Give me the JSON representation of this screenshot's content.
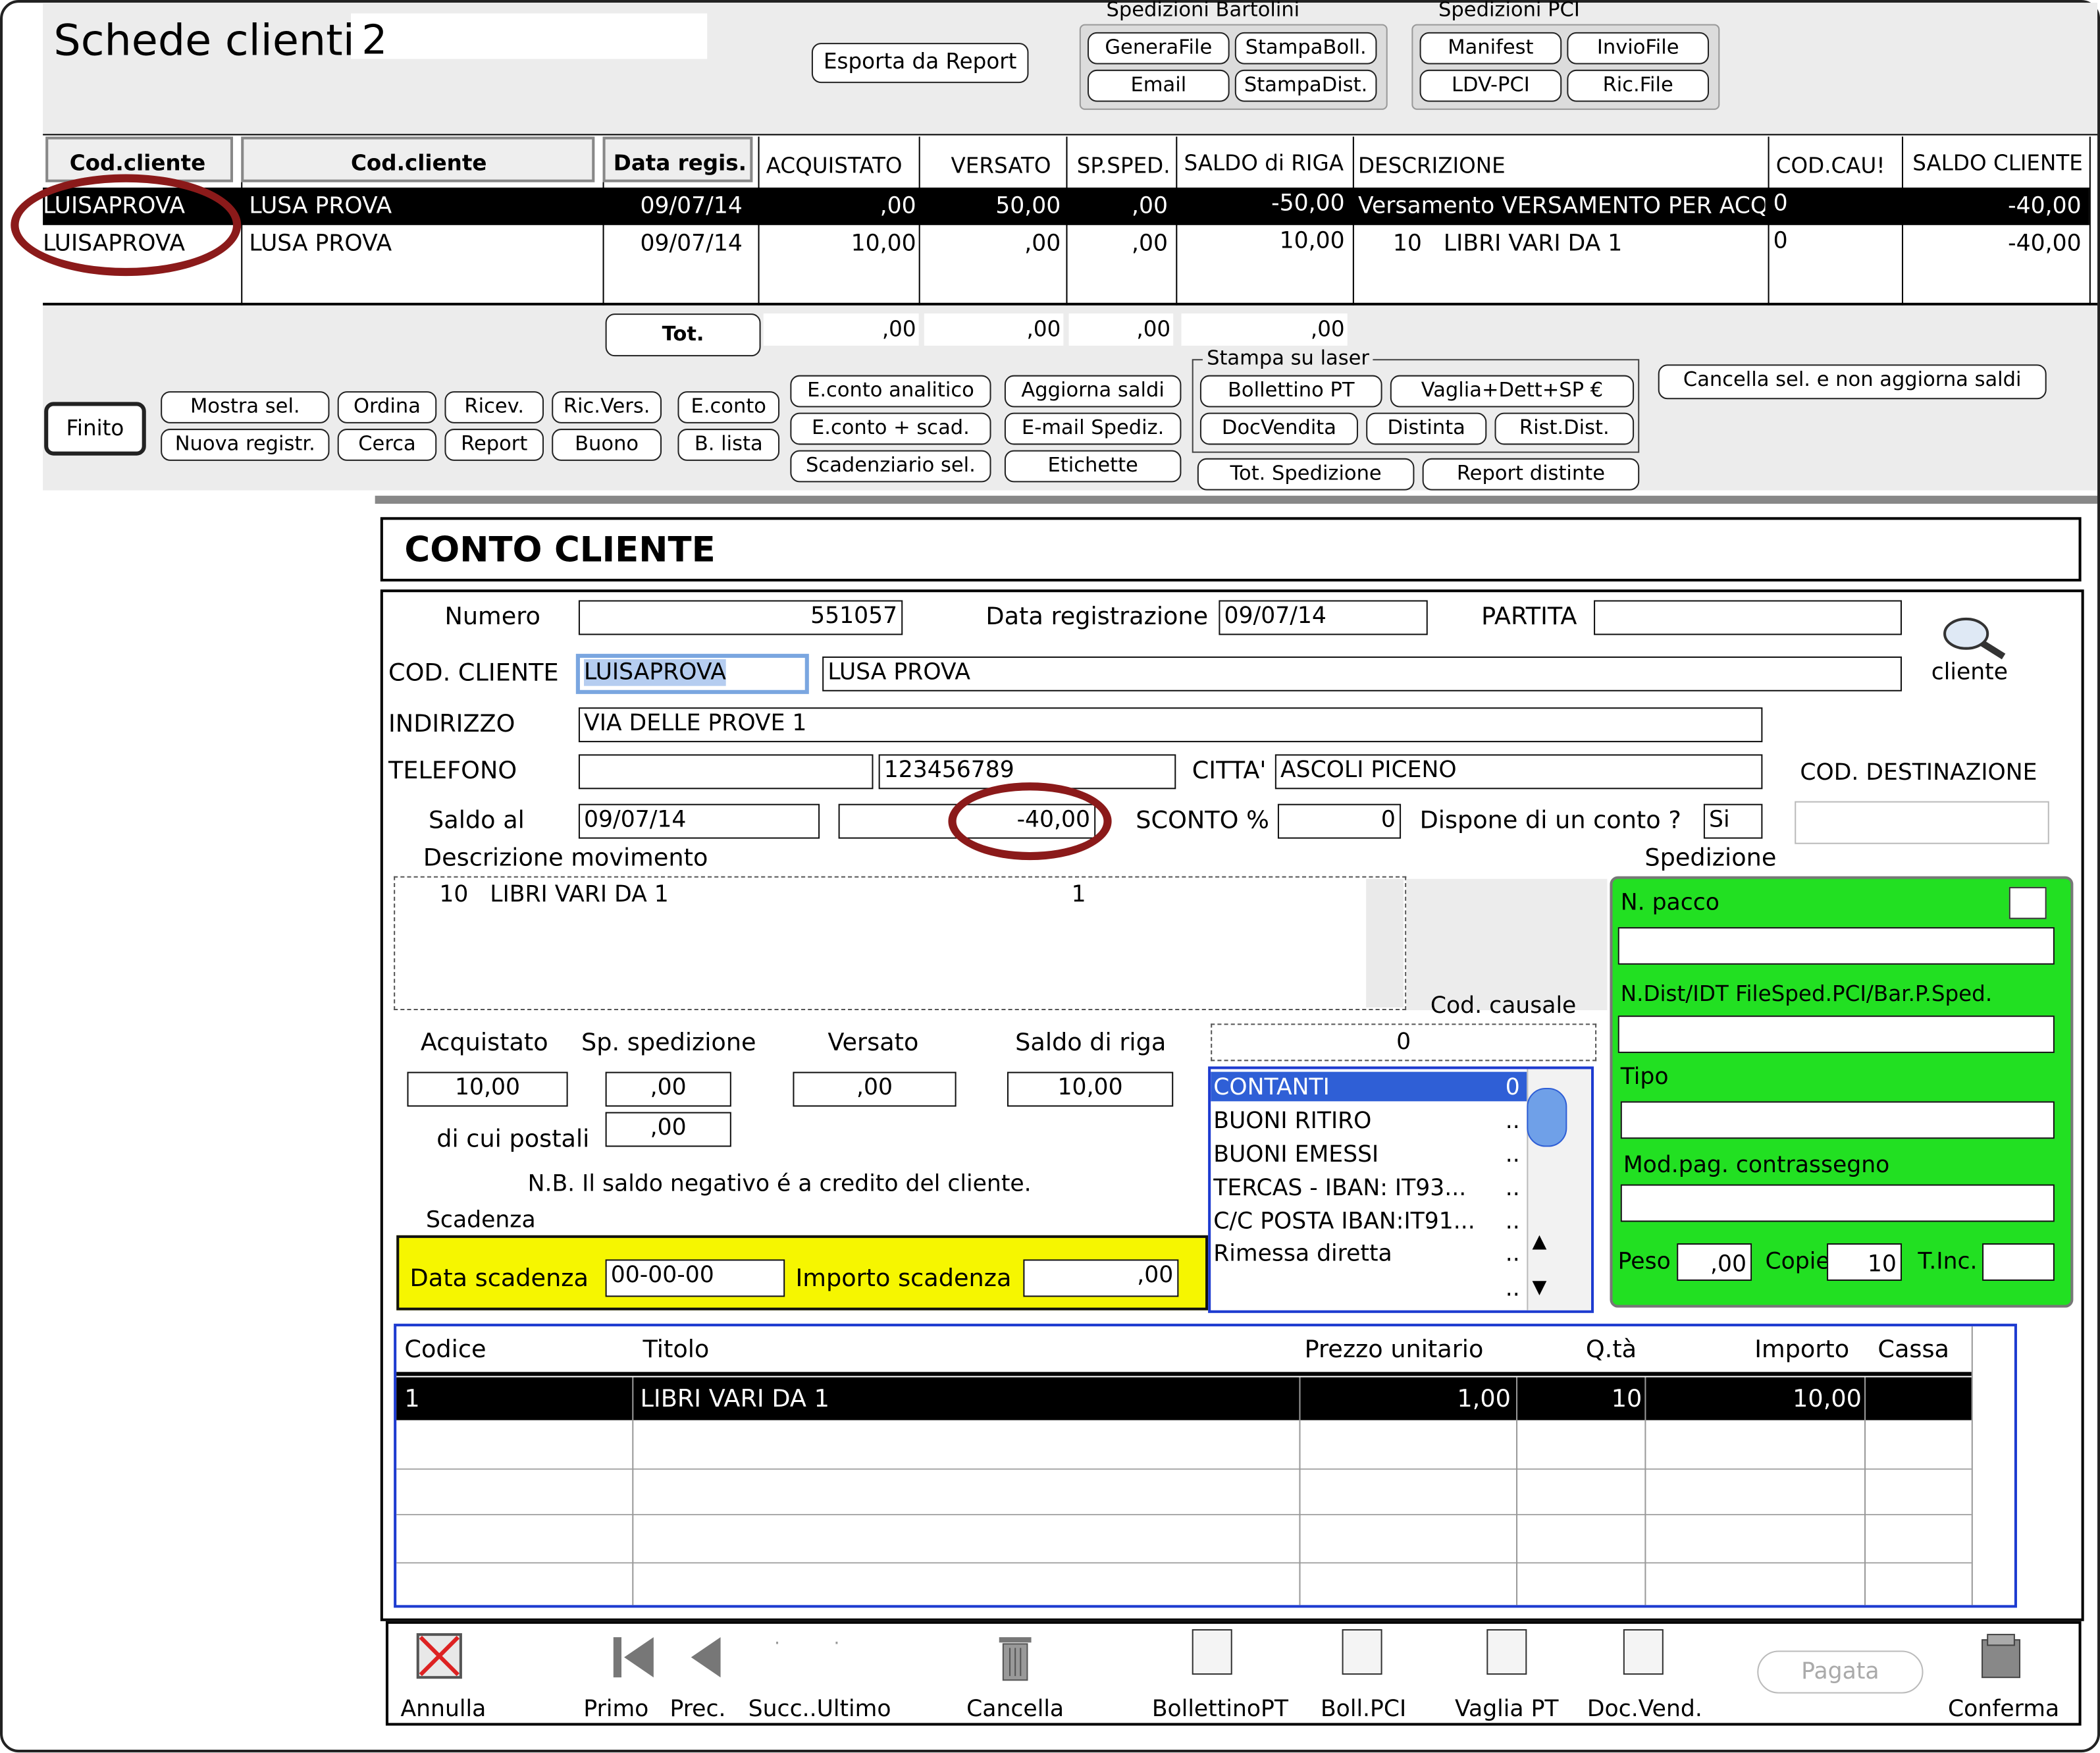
{
  "window": {
    "title": "Schede clienti",
    "count": "2"
  },
  "header_buttons": {
    "esporta": "Esporta da Report"
  },
  "bartolini": {
    "title": "Spedizioni Bartolini",
    "buttons": [
      "GeneraFile",
      "StampaBoll.",
      "Email",
      "StampaDist."
    ]
  },
  "pci": {
    "title": "Spedizioni PCI",
    "buttons": [
      "Manifest",
      "InvioFile",
      "LDV-PCI",
      "Ric.File"
    ]
  },
  "list": {
    "headers": [
      "Cod.cliente",
      "Cod.cliente",
      "Data regis.",
      "ACQUISTATO",
      "VERSATO",
      "SP.SPED.",
      "SALDO di RIGA",
      "DESCRIZIONE",
      "COD.CAU!",
      "SALDO CLIENTE"
    ],
    "rows": [
      {
        "cod": "LUISAPROVA",
        "nome": "LUSA PROVA",
        "data": "09/07/14",
        "acquistato": ",00",
        "versato": "50,00",
        "sped": ",00",
        "saldo_riga": "-50,00",
        "descrizione": "Versamento VERSAMENTO PER ACQU",
        "cau": "0",
        "saldo_cliente": "-40,00"
      },
      {
        "cod": "LUISAPROVA",
        "nome": "LUSA PROVA",
        "data": "09/07/14",
        "acquistato": "10,00",
        "versato": ",00",
        "sped": ",00",
        "saldo_riga": "10,00",
        "descrizione": "10   LIBRI VARI DA 1",
        "cau": "0",
        "saldo_cliente": "-40,00"
      }
    ],
    "totals": {
      "button": "Tot.",
      "acquistato": ",00",
      "versato": ",00",
      "sped": ",00",
      "saldo": ",00"
    }
  },
  "actions": {
    "finito": "Finito",
    "mostra": "Mostra sel.",
    "nuova": "Nuova registr.",
    "ordina": "Ordina",
    "cerca": "Cerca",
    "ricev": "Ricev.",
    "report": "Report",
    "ricvers": "Ric.Vers.",
    "buono": "Buono",
    "econto": "E.conto",
    "blista": "B. lista",
    "econto_anal": "E.conto analitico",
    "econto_scad": "E.conto + scad.",
    "scadenziario": "Scadenziario sel.",
    "aggiorna": "Aggiorna saldi",
    "email_sped": "E-mail Spediz.",
    "etichette": "Etichette",
    "laser_title": "Stampa su laser",
    "bollettino": "Bollettino PT",
    "vaglia": "Vaglia+Dett+SP €",
    "docvendita": "DocVendita",
    "distinta": "Distinta",
    "rist": "Rist.Dist.",
    "tot_sped": "Tot. Spedizione",
    "report_dist": "Report distinte",
    "cancella": "Cancella sel. e non aggiorna saldi"
  },
  "form": {
    "title": "CONTO  CLIENTE",
    "numero_label": "Numero",
    "numero": "551057",
    "data_label": "Data registrazione",
    "data": "09/07/14",
    "partita_label": "PARTITA",
    "partita": "",
    "cliente_icon_label": "cliente",
    "cod_label": "COD. CLIENTE",
    "cod": "LUISAPROVA",
    "nome": "LUSA PROVA",
    "indirizzo_label": "INDIRIZZO",
    "indirizzo": "VIA DELLE PROVE 1",
    "telefono_label": "TELEFONO",
    "telefono1": "",
    "telefono2": "123456789",
    "citta_label": "CITTA'",
    "citta": "ASCOLI PICENO",
    "cod_dest_label": "COD. DESTINAZIONE",
    "cod_dest": "",
    "saldo_label": "Saldo al",
    "saldo_data": "09/07/14",
    "saldo": "-40,00",
    "sconto_label": "SCONTO %",
    "sconto": "0",
    "dispone_label": "Dispone di un conto ?",
    "dispone": "Si",
    "desc_label": "Descrizione movimento",
    "desc_text": "10   LIBRI VARI DA 1",
    "desc_qty": "1",
    "acquistato_label": "Acquistato",
    "acquistato": "10,00",
    "spsped_label": "Sp. spedizione",
    "spsped": ",00",
    "versato_label": "Versato",
    "versato": ",00",
    "saldoriga_label": "Saldo di riga",
    "saldoriga": "10,00",
    "postali_label": "di cui postali",
    "postali": ",00",
    "nb": "N.B.  Il saldo negativo é a credito del cliente.",
    "scadenza_label": "Scadenza",
    "data_scad_label": "Data scadenza",
    "data_scad": "00-00-00",
    "importo_scad_label": "Importo scadenza",
    "importo_scad": ",00",
    "causale_label": "Cod. causale",
    "causale": "0",
    "causali": [
      {
        "label": "CONTANTI",
        "code": "0"
      },
      {
        "label": "BUONI RITIRO",
        "code": ".."
      },
      {
        "label": "BUONI EMESSI",
        "code": ".."
      },
      {
        "label": "TERCAS - IBAN: IT93...",
        "code": ".."
      },
      {
        "label": "C/C POSTA IBAN:IT91...",
        "code": ".."
      },
      {
        "label": "Rimessa diretta",
        "code": ".."
      },
      {
        "label": "",
        "code": ".."
      }
    ]
  },
  "spedizione": {
    "title": "Spedizione",
    "npacco_label": "N. pacco",
    "ndist_label": "N.Dist/IDT FileSped.PCI/Bar.P.Sped.",
    "tipo_label": "Tipo",
    "modpag_label": "Mod.pag. contrassegno",
    "peso_label": "Peso",
    "peso": ",00",
    "copie_label": "Copie",
    "copie": "10",
    "tinc_label": "T.Inc."
  },
  "items": {
    "headers": {
      "codice": "Codice",
      "titolo": "Titolo",
      "prezzo": "Prezzo unitario",
      "qta": "Q.tà",
      "importo": "Importo",
      "cassa": "Cassa"
    },
    "rows": [
      {
        "codice": "1",
        "titolo": "LIBRI VARI DA 1",
        "prezzo": "1,00",
        "qta": "10",
        "importo": "10,00",
        "cassa": ""
      }
    ]
  },
  "toolbar": {
    "annulla": "Annulla",
    "primo": "Primo",
    "prec": "Prec.",
    "succ": "Succ..Ultimo",
    "cancella": "Cancella",
    "bollettino": "BollettinoPT",
    "bollpci": "Boll.PCI",
    "vaglia": "Vaglia PT",
    "docvend": "Doc.Vend.",
    "pagata": "Pagata",
    "conferma": "Conferma"
  },
  "colors": {
    "green": "#22e022",
    "yellow": "#f6f600",
    "highlight": "#2f5fd6",
    "annotation": "#8b1a1a"
  }
}
